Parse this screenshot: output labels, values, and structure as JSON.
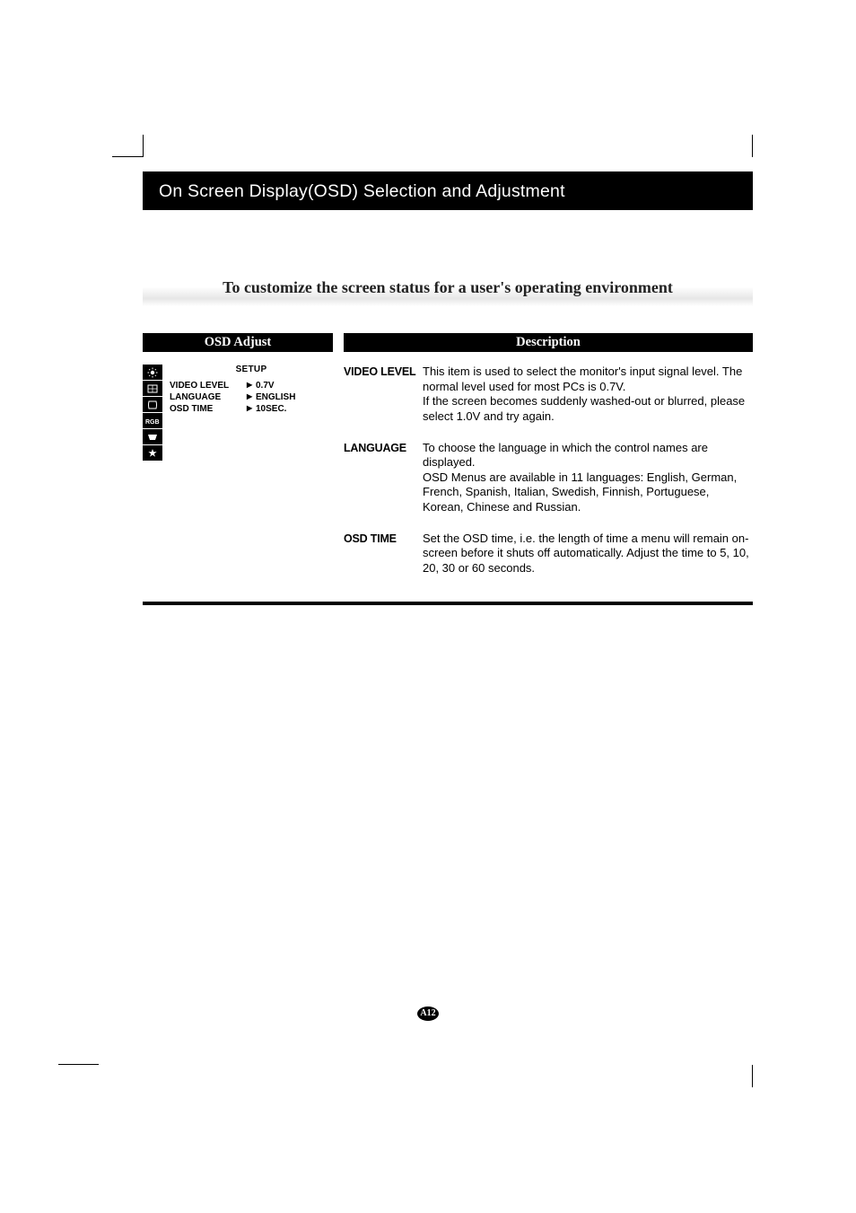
{
  "header": {
    "title": "On Screen Display(OSD) Selection and Adjustment"
  },
  "subtitle": "To customize the screen status for a user's operating environment",
  "table": {
    "left_header": "OSD Adjust",
    "right_header": "Description"
  },
  "osd_panel": {
    "title": "SETUP",
    "rows": [
      {
        "label": "VIDEO LEVEL",
        "value": "0.7V"
      },
      {
        "label": "LANGUAGE",
        "value": "ENGLISH"
      },
      {
        "label": "OSD TIME",
        "value": "10SEC."
      }
    ]
  },
  "descriptions": [
    {
      "term": "VIDEO LEVEL",
      "body": "This item is used to select the monitor's input signal level. The normal level used for most PCs is 0.7V.\nIf the screen becomes suddenly washed-out or blurred, please select 1.0V and try again."
    },
    {
      "term": "LANGUAGE",
      "body": "To choose the language in which the control names are displayed.\nOSD Menus are available in 11 languages: English, German, French, Spanish, Italian, Swedish, Finnish, Portuguese, Korean, Chinese and Russian."
    },
    {
      "term": "OSD TIME",
      "body": "Set the OSD time, i.e. the length of time a menu will remain on-screen before it shuts off automatically. Adjust the time to 5, 10, 20, 30 or 60 seconds."
    }
  ],
  "page_number": "A12",
  "icons": {
    "sun": "brightness-icon",
    "size": "position-icon",
    "geo": "geometry-icon",
    "rgb": "color-icon",
    "setup": "setup-icon",
    "special": "special-icon"
  }
}
